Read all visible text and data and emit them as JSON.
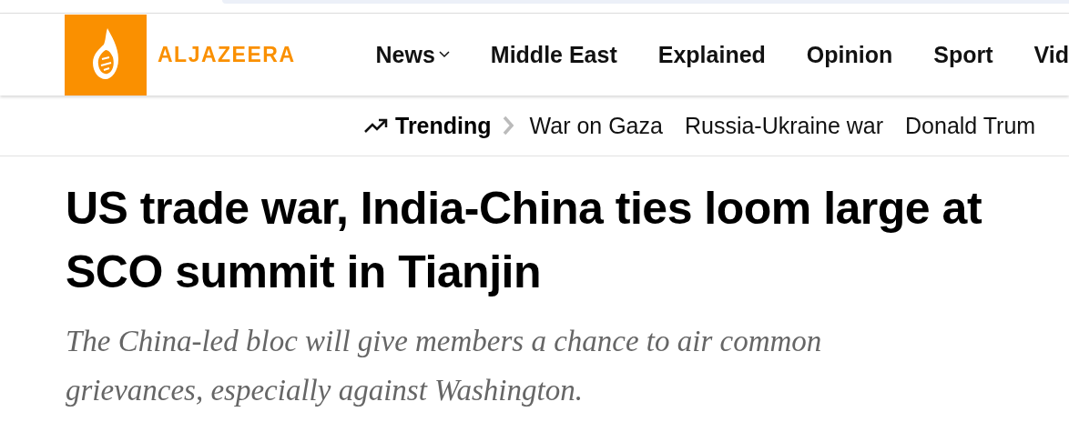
{
  "header": {
    "logo_text": "ALJAZEERA",
    "nav": [
      {
        "label": "News",
        "dropdown": true
      },
      {
        "label": "Middle East",
        "dropdown": false
      },
      {
        "label": "Explained",
        "dropdown": false
      },
      {
        "label": "Opinion",
        "dropdown": false
      },
      {
        "label": "Sport",
        "dropdown": false
      },
      {
        "label": "Vid",
        "dropdown": false
      }
    ]
  },
  "trending": {
    "label": "Trending",
    "topics": [
      "War on Gaza",
      "Russia-Ukraine war",
      "Donald Trum"
    ]
  },
  "article": {
    "headline": "US trade war, India-China ties loom large at SCO summit in Tianjin",
    "standfirst": "The China-led bloc will give members a chance to air common grievances, especially against Washington."
  }
}
